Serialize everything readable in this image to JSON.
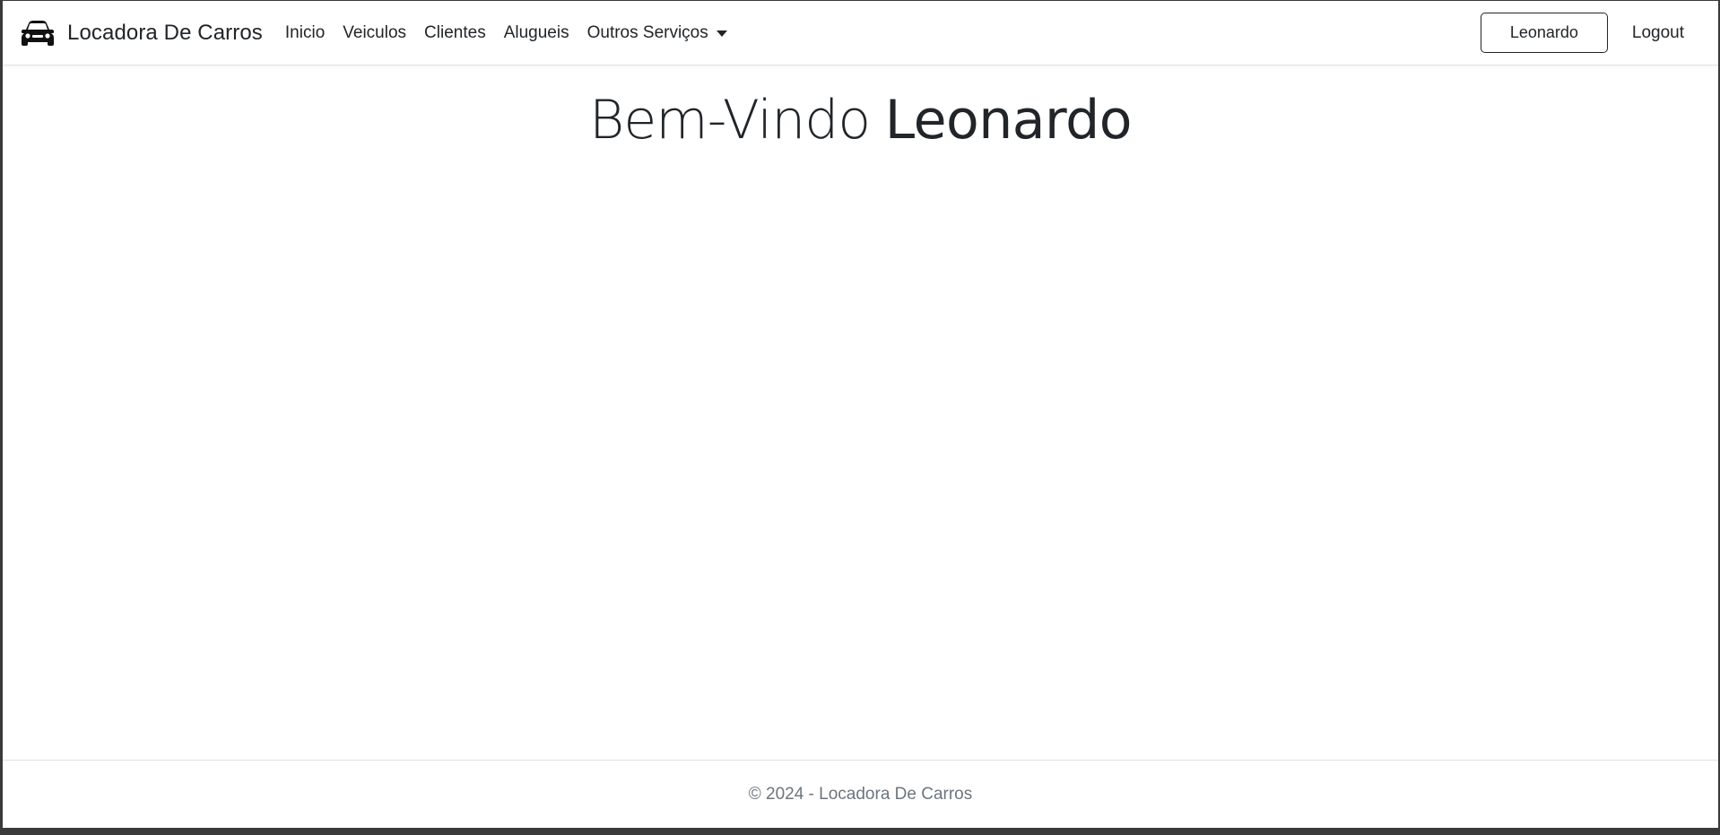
{
  "navbar": {
    "brand": {
      "icon": "car-icon",
      "label": "Locadora De Carros"
    },
    "links": [
      {
        "label": "Inicio"
      },
      {
        "label": "Veiculos"
      },
      {
        "label": "Clientes"
      },
      {
        "label": "Alugueis"
      }
    ],
    "dropdown": {
      "label": "Outros Serviços",
      "icon": "caret-down-icon"
    },
    "user_button_label": "Leonardo",
    "logout_label": "Logout"
  },
  "main": {
    "greeting": "Bem-Vindo",
    "username": "Leonardo"
  },
  "footer": {
    "text": "© 2024 - Locadora De Carros"
  },
  "colors": {
    "text": "#212529",
    "muted": "#6c757d",
    "border": "#dee2e6",
    "background": "#ffffff"
  }
}
